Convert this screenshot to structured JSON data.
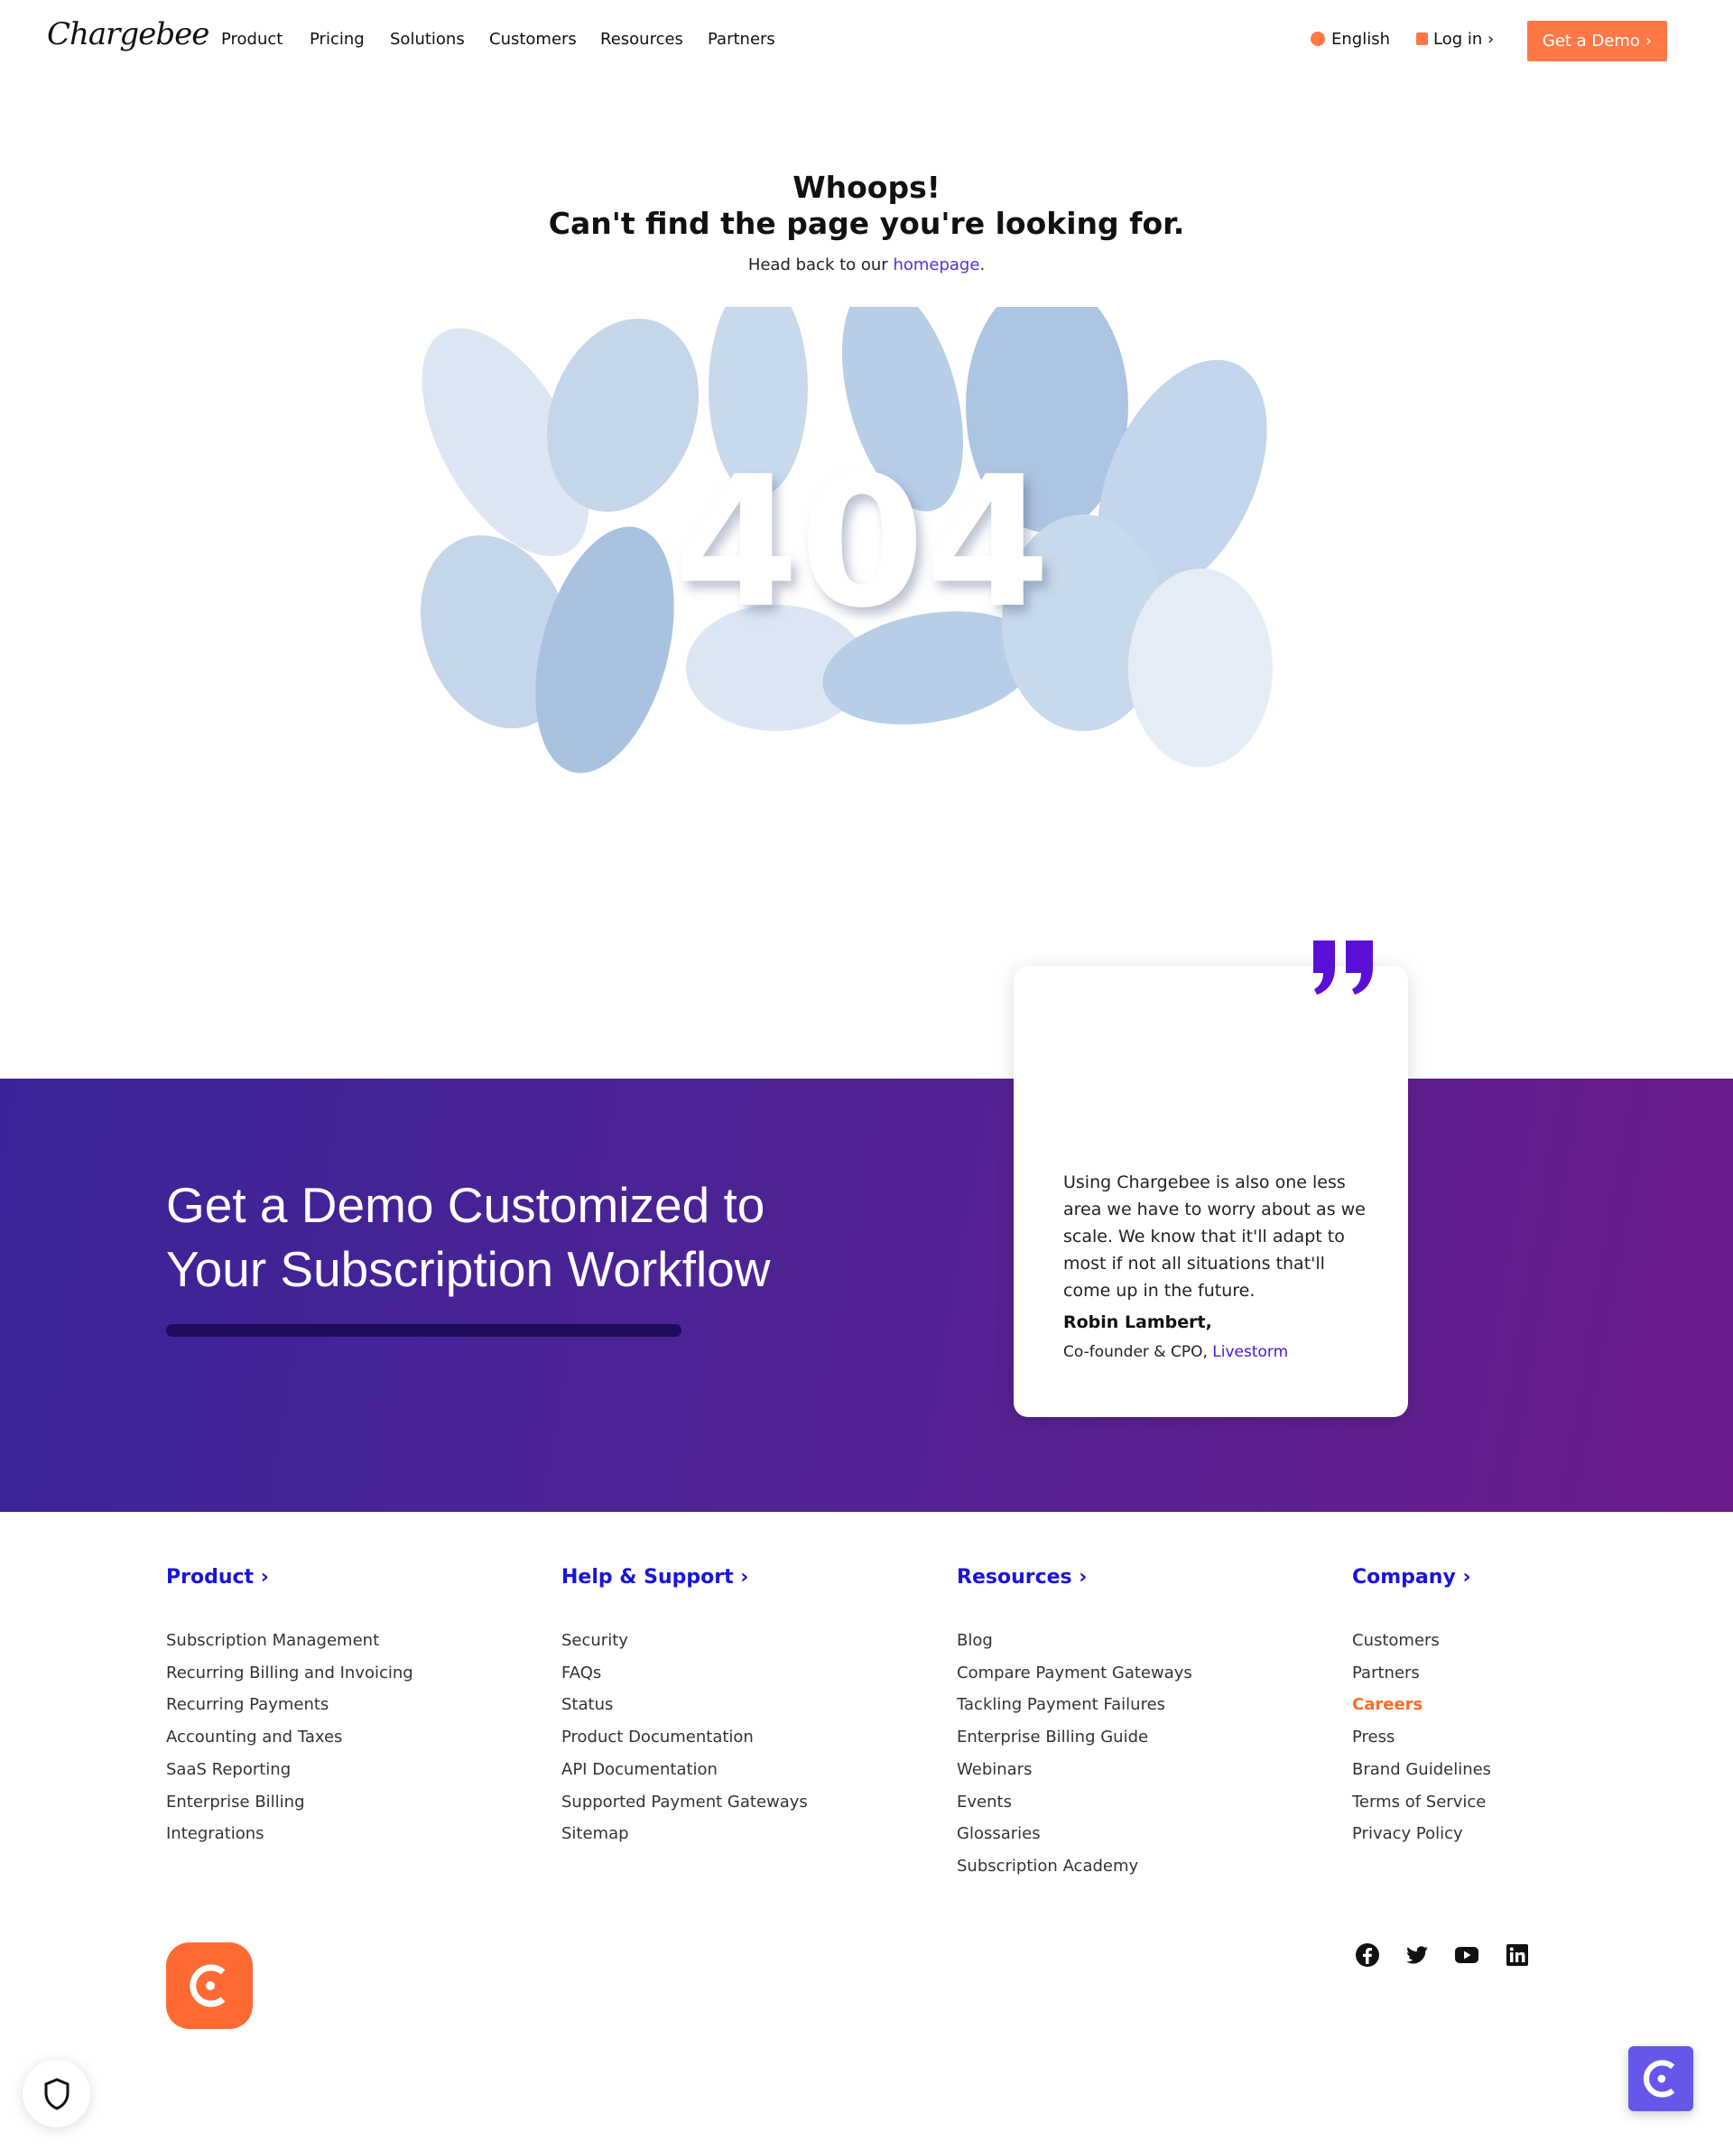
{
  "header": {
    "logo": "Chargebee",
    "nav": [
      "Product",
      "Pricing",
      "Solutions",
      "Customers",
      "Resources",
      "Partners"
    ],
    "language": "English",
    "login": "Log in",
    "demo": "Get a Demo",
    "accent": "#ff7846"
  },
  "hero": {
    "title1": "Whoops!",
    "title2": "Can't find the page you're looking for.",
    "sub_prefix": "Head back to our ",
    "sub_link": "homepage",
    "sub_suffix": ".",
    "illustration_text": "404"
  },
  "cta": {
    "heading_line1": "Get a Demo Customized to",
    "heading_line2": "Your Subscription Workflow"
  },
  "testimonial": {
    "quote": "Using Chargebee is also one less area we have to worry about as we scale. We know that it'll adapt to most if not all situations that'll come up in the future.",
    "name": "Robin Lambert,",
    "role": "Co-founder & CPO, ",
    "company": "Livestorm"
  },
  "footer": {
    "columns": [
      {
        "title": "Product",
        "items": [
          "Subscription Management",
          "Recurring Billing and Invoicing",
          "Recurring Payments",
          "Accounting and Taxes",
          "SaaS Reporting",
          "Enterprise Billing",
          "Integrations"
        ]
      },
      {
        "title": "Help & Support",
        "items": [
          "Security",
          "FAQs",
          "Status",
          "Product Documentation",
          "API Documentation",
          "Supported Payment Gateways",
          "Sitemap"
        ]
      },
      {
        "title": "Resources",
        "items": [
          "Blog",
          "Compare Payment Gateways",
          "Tackling Payment Failures",
          "Enterprise Billing Guide",
          "Webinars",
          "Events",
          "Glossaries",
          "Subscription Academy"
        ]
      },
      {
        "title": "Company",
        "items": [
          "Customers",
          "Partners",
          "Careers",
          "Press",
          "Brand Guidelines",
          "Terms of Service",
          "Privacy Policy"
        ]
      }
    ],
    "highlight": "Careers",
    "social": [
      "facebook-icon",
      "twitter-icon",
      "youtube-icon",
      "linkedin-icon"
    ]
  }
}
